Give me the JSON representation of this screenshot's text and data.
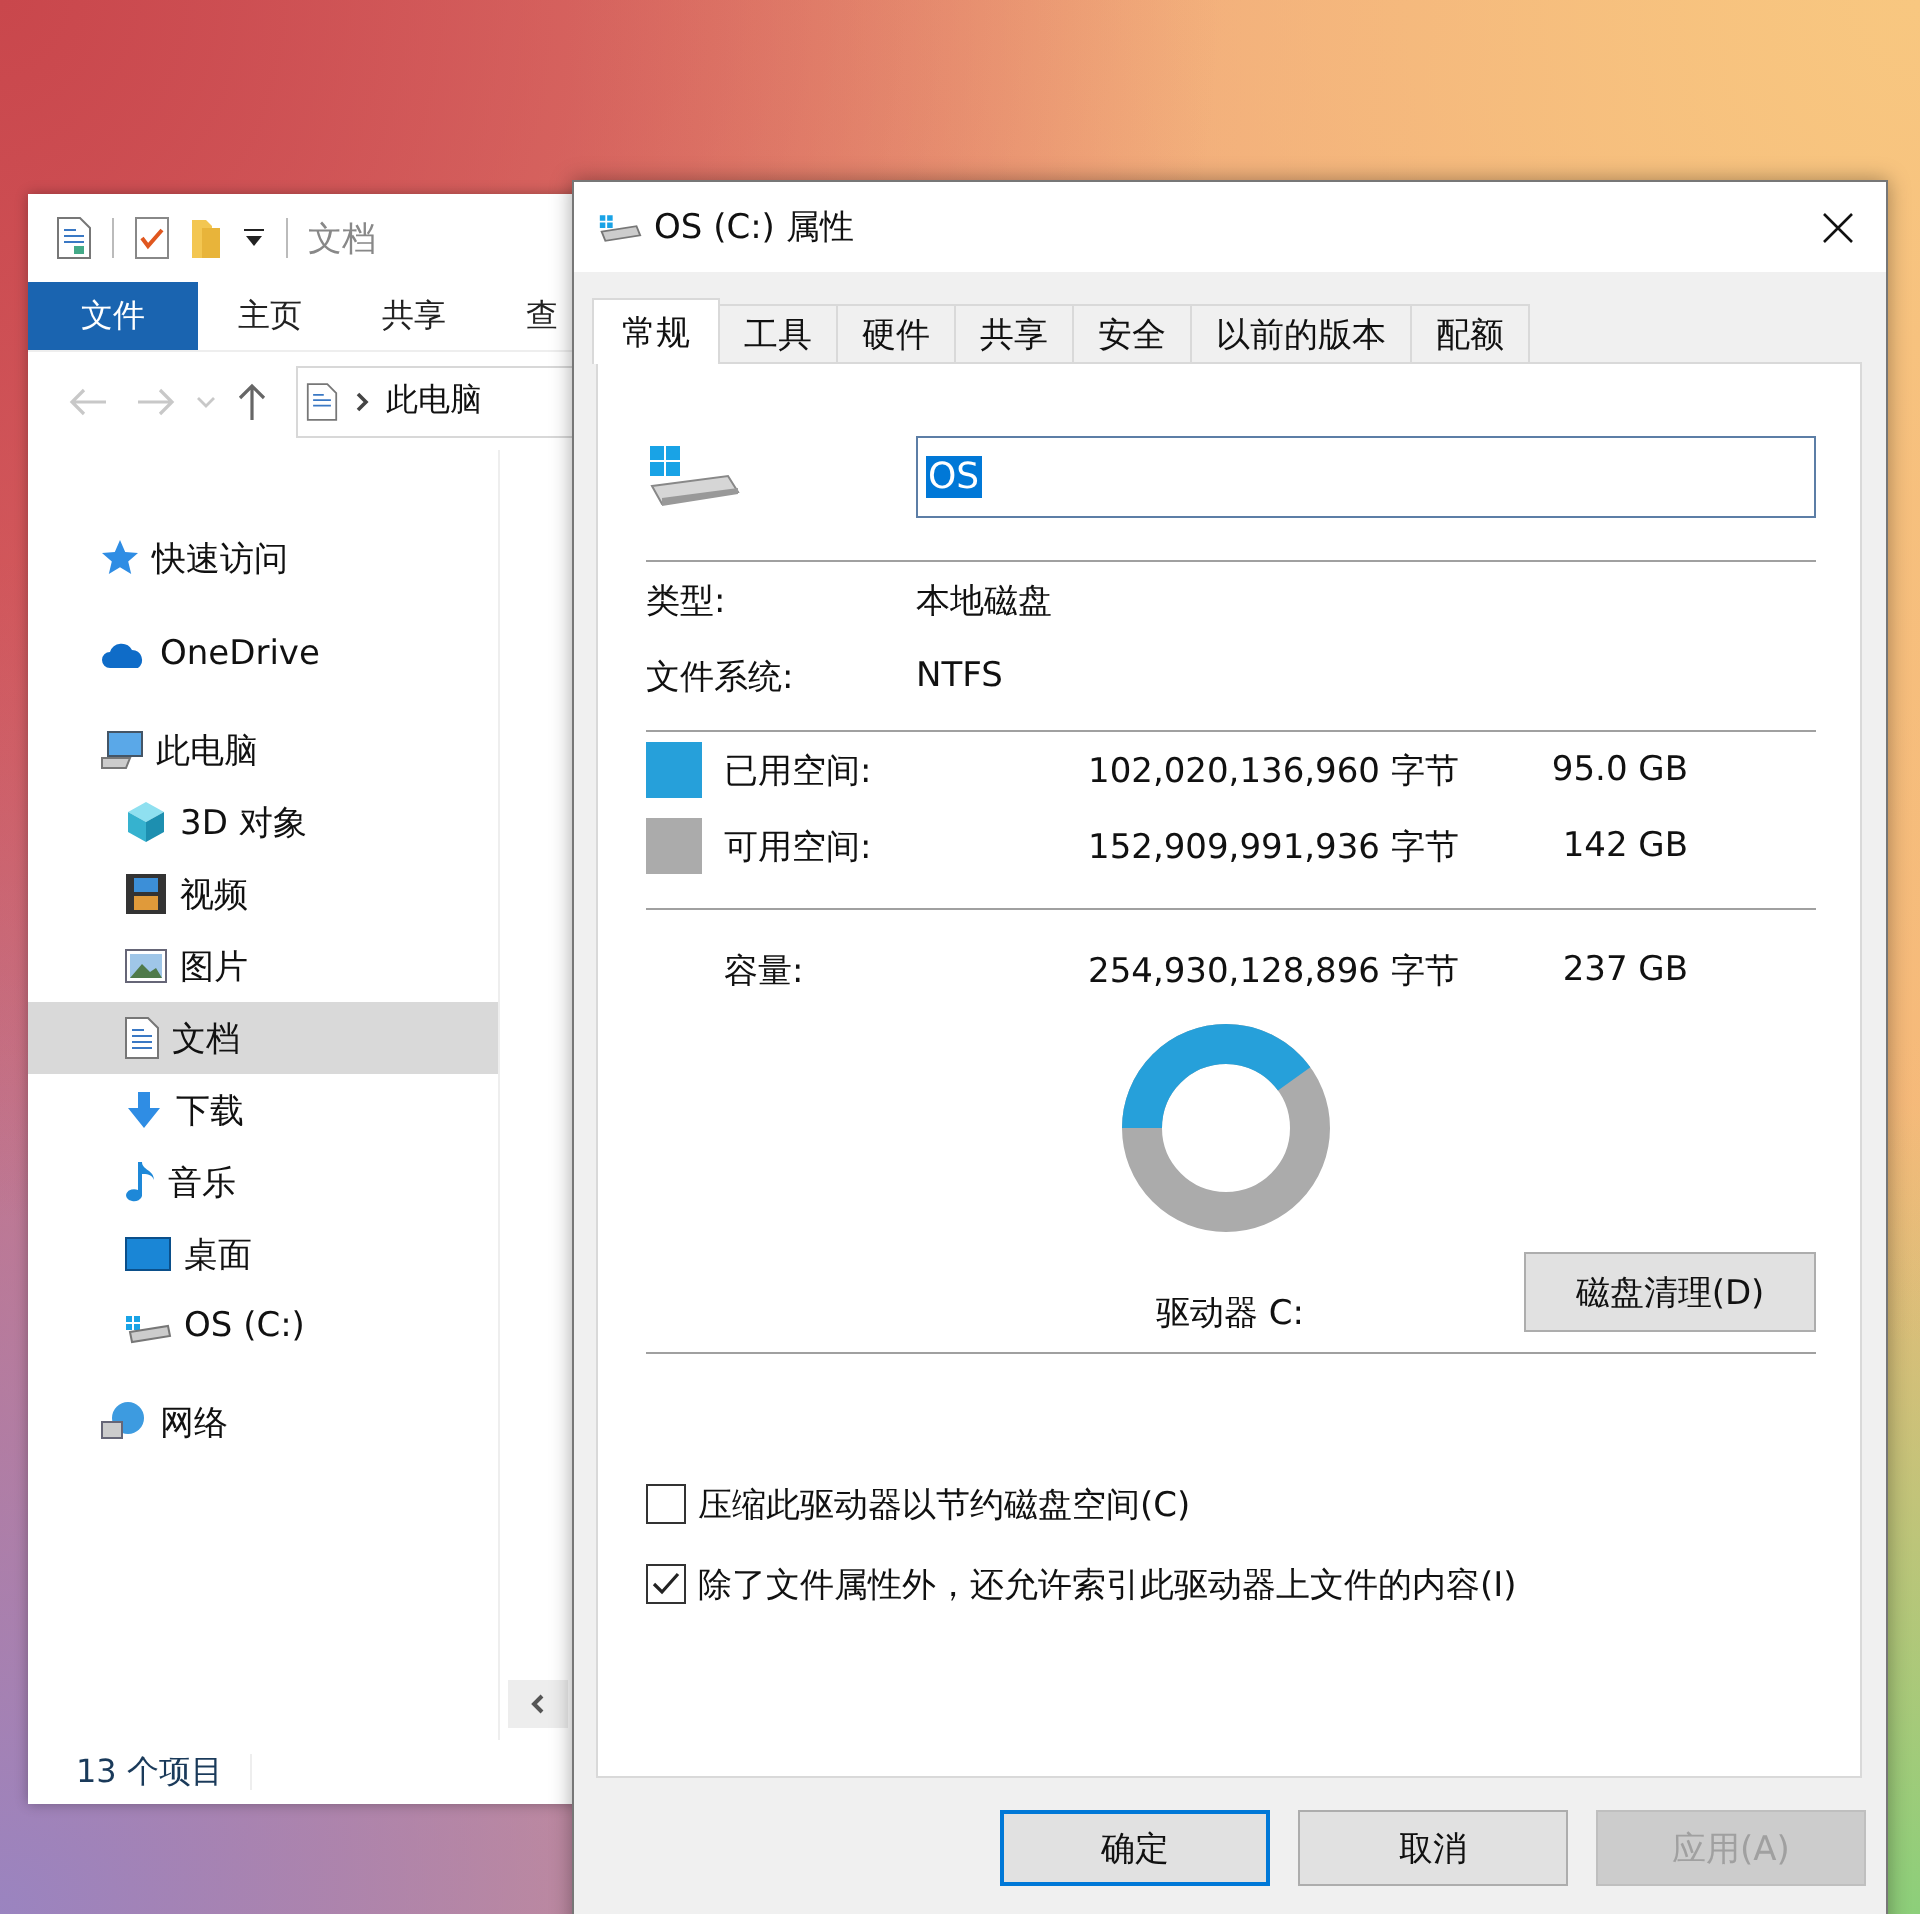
{
  "explorer": {
    "title": "文档",
    "ribbon_tabs": [
      {
        "label": "文件",
        "selected": true
      },
      {
        "label": "主页",
        "selected": false
      },
      {
        "label": "共享",
        "selected": false
      },
      {
        "label": "查",
        "selected": false
      }
    ],
    "address": "此电脑",
    "sidebar": [
      {
        "label": "快速访问",
        "kind": "star",
        "selected": false
      },
      {
        "label": "OneDrive",
        "kind": "cloud",
        "selected": false
      },
      {
        "label": "此电脑",
        "kind": "pc",
        "selected": false,
        "children": [
          {
            "label": "3D 对象",
            "kind": "cube",
            "selected": false
          },
          {
            "label": "视频",
            "kind": "film",
            "selected": false
          },
          {
            "label": "图片",
            "kind": "image",
            "selected": false
          },
          {
            "label": "文档",
            "kind": "doc",
            "selected": true
          },
          {
            "label": "下载",
            "kind": "download",
            "selected": false
          },
          {
            "label": "音乐",
            "kind": "music",
            "selected": false
          },
          {
            "label": "桌面",
            "kind": "desktop",
            "selected": false
          },
          {
            "label": "OS (C:)",
            "kind": "drive",
            "selected": false
          }
        ]
      },
      {
        "label": "网络",
        "kind": "network",
        "selected": false
      }
    ],
    "status_bar": "13 个项目"
  },
  "dialog": {
    "title": "OS (C:) 属性",
    "tabs": [
      {
        "label": "常规",
        "selected": true
      },
      {
        "label": "工具",
        "selected": false
      },
      {
        "label": "硬件",
        "selected": false
      },
      {
        "label": "共享",
        "selected": false
      },
      {
        "label": "安全",
        "selected": false
      },
      {
        "label": "以前的版本",
        "selected": false
      },
      {
        "label": "配额",
        "selected": false
      }
    ],
    "name_field": {
      "value": "OS",
      "text_selected": true
    },
    "info": [
      {
        "label": "类型:",
        "value": "本地磁盘"
      },
      {
        "label": "文件系统:",
        "value": "NTFS"
      }
    ],
    "space": [
      {
        "label": "已用空间:",
        "bytes": "102,020,136,960 字节",
        "size": "95.0 GB",
        "color": "#26a0da"
      },
      {
        "label": "可用空间:",
        "bytes": "152,909,991,936 字节",
        "size": "142 GB",
        "color": "#ababab"
      }
    ],
    "capacity": {
      "label": "容量:",
      "bytes": "254,930,128,896 字节",
      "size": "237 GB"
    },
    "usage": {
      "level": 0.4
    },
    "drive_label": "驱动器 C:",
    "cleanup_button": "磁盘清理(D)",
    "options": [
      {
        "label": "压缩此驱动器以节约磁盘空间(C)",
        "checked": false
      },
      {
        "label": "除了文件属性外，还允许索引此驱动器上文件的内容(I)",
        "checked": true
      }
    ],
    "buttons": [
      {
        "label": "确定",
        "default": true,
        "disabled": false
      },
      {
        "label": "取消",
        "default": false,
        "disabled": false
      },
      {
        "label": "应用(A)",
        "default": false,
        "disabled": true
      }
    ]
  }
}
